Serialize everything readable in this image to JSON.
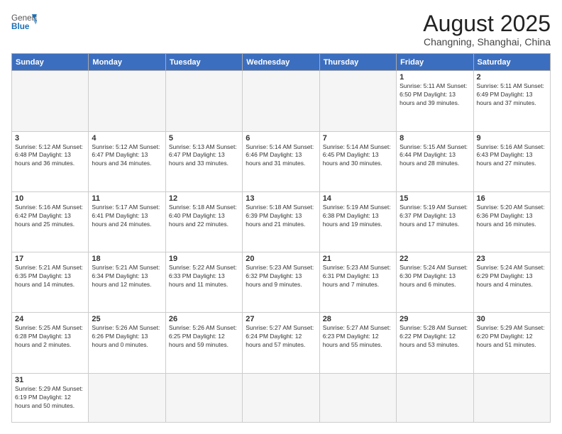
{
  "header": {
    "logo_general": "General",
    "logo_blue": "Blue",
    "title": "August 2025",
    "subtitle": "Changning, Shanghai, China"
  },
  "weekdays": [
    "Sunday",
    "Monday",
    "Tuesday",
    "Wednesday",
    "Thursday",
    "Friday",
    "Saturday"
  ],
  "weeks": [
    [
      {
        "day": "",
        "info": ""
      },
      {
        "day": "",
        "info": ""
      },
      {
        "day": "",
        "info": ""
      },
      {
        "day": "",
        "info": ""
      },
      {
        "day": "",
        "info": ""
      },
      {
        "day": "1",
        "info": "Sunrise: 5:11 AM\nSunset: 6:50 PM\nDaylight: 13 hours and 39 minutes."
      },
      {
        "day": "2",
        "info": "Sunrise: 5:11 AM\nSunset: 6:49 PM\nDaylight: 13 hours and 37 minutes."
      }
    ],
    [
      {
        "day": "3",
        "info": "Sunrise: 5:12 AM\nSunset: 6:48 PM\nDaylight: 13 hours and 36 minutes."
      },
      {
        "day": "4",
        "info": "Sunrise: 5:12 AM\nSunset: 6:47 PM\nDaylight: 13 hours and 34 minutes."
      },
      {
        "day": "5",
        "info": "Sunrise: 5:13 AM\nSunset: 6:47 PM\nDaylight: 13 hours and 33 minutes."
      },
      {
        "day": "6",
        "info": "Sunrise: 5:14 AM\nSunset: 6:46 PM\nDaylight: 13 hours and 31 minutes."
      },
      {
        "day": "7",
        "info": "Sunrise: 5:14 AM\nSunset: 6:45 PM\nDaylight: 13 hours and 30 minutes."
      },
      {
        "day": "8",
        "info": "Sunrise: 5:15 AM\nSunset: 6:44 PM\nDaylight: 13 hours and 28 minutes."
      },
      {
        "day": "9",
        "info": "Sunrise: 5:16 AM\nSunset: 6:43 PM\nDaylight: 13 hours and 27 minutes."
      }
    ],
    [
      {
        "day": "10",
        "info": "Sunrise: 5:16 AM\nSunset: 6:42 PM\nDaylight: 13 hours and 25 minutes."
      },
      {
        "day": "11",
        "info": "Sunrise: 5:17 AM\nSunset: 6:41 PM\nDaylight: 13 hours and 24 minutes."
      },
      {
        "day": "12",
        "info": "Sunrise: 5:18 AM\nSunset: 6:40 PM\nDaylight: 13 hours and 22 minutes."
      },
      {
        "day": "13",
        "info": "Sunrise: 5:18 AM\nSunset: 6:39 PM\nDaylight: 13 hours and 21 minutes."
      },
      {
        "day": "14",
        "info": "Sunrise: 5:19 AM\nSunset: 6:38 PM\nDaylight: 13 hours and 19 minutes."
      },
      {
        "day": "15",
        "info": "Sunrise: 5:19 AM\nSunset: 6:37 PM\nDaylight: 13 hours and 17 minutes."
      },
      {
        "day": "16",
        "info": "Sunrise: 5:20 AM\nSunset: 6:36 PM\nDaylight: 13 hours and 16 minutes."
      }
    ],
    [
      {
        "day": "17",
        "info": "Sunrise: 5:21 AM\nSunset: 6:35 PM\nDaylight: 13 hours and 14 minutes."
      },
      {
        "day": "18",
        "info": "Sunrise: 5:21 AM\nSunset: 6:34 PM\nDaylight: 13 hours and 12 minutes."
      },
      {
        "day": "19",
        "info": "Sunrise: 5:22 AM\nSunset: 6:33 PM\nDaylight: 13 hours and 11 minutes."
      },
      {
        "day": "20",
        "info": "Sunrise: 5:23 AM\nSunset: 6:32 PM\nDaylight: 13 hours and 9 minutes."
      },
      {
        "day": "21",
        "info": "Sunrise: 5:23 AM\nSunset: 6:31 PM\nDaylight: 13 hours and 7 minutes."
      },
      {
        "day": "22",
        "info": "Sunrise: 5:24 AM\nSunset: 6:30 PM\nDaylight: 13 hours and 6 minutes."
      },
      {
        "day": "23",
        "info": "Sunrise: 5:24 AM\nSunset: 6:29 PM\nDaylight: 13 hours and 4 minutes."
      }
    ],
    [
      {
        "day": "24",
        "info": "Sunrise: 5:25 AM\nSunset: 6:28 PM\nDaylight: 13 hours and 2 minutes."
      },
      {
        "day": "25",
        "info": "Sunrise: 5:26 AM\nSunset: 6:26 PM\nDaylight: 13 hours and 0 minutes."
      },
      {
        "day": "26",
        "info": "Sunrise: 5:26 AM\nSunset: 6:25 PM\nDaylight: 12 hours and 59 minutes."
      },
      {
        "day": "27",
        "info": "Sunrise: 5:27 AM\nSunset: 6:24 PM\nDaylight: 12 hours and 57 minutes."
      },
      {
        "day": "28",
        "info": "Sunrise: 5:27 AM\nSunset: 6:23 PM\nDaylight: 12 hours and 55 minutes."
      },
      {
        "day": "29",
        "info": "Sunrise: 5:28 AM\nSunset: 6:22 PM\nDaylight: 12 hours and 53 minutes."
      },
      {
        "day": "30",
        "info": "Sunrise: 5:29 AM\nSunset: 6:20 PM\nDaylight: 12 hours and 51 minutes."
      }
    ],
    [
      {
        "day": "31",
        "info": "Sunrise: 5:29 AM\nSunset: 6:19 PM\nDaylight: 12 hours and 50 minutes."
      },
      {
        "day": "",
        "info": ""
      },
      {
        "day": "",
        "info": ""
      },
      {
        "day": "",
        "info": ""
      },
      {
        "day": "",
        "info": ""
      },
      {
        "day": "",
        "info": ""
      },
      {
        "day": "",
        "info": ""
      }
    ]
  ]
}
